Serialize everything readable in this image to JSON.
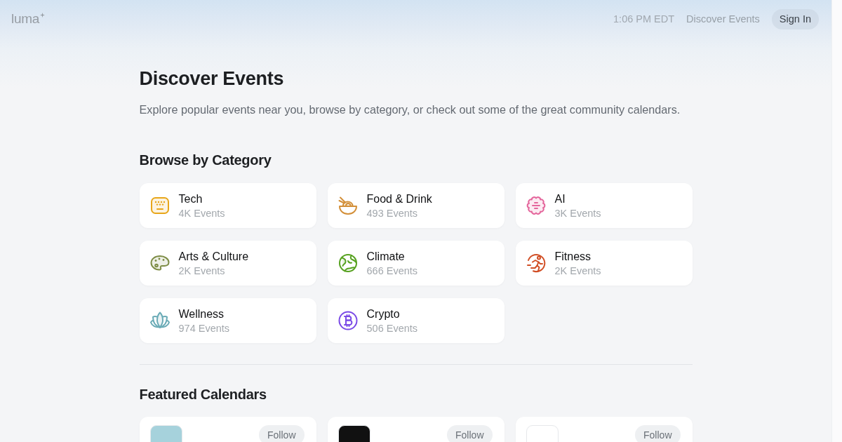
{
  "header": {
    "logo": "luma",
    "time": "1:06 PM EDT",
    "nav_link": "Discover Events",
    "sign_in": "Sign In"
  },
  "page": {
    "title": "Discover Events",
    "subtitle": "Explore popular events near you, browse by category, or check out some of the great community calendars."
  },
  "categories_section": {
    "heading": "Browse by Category",
    "items": [
      {
        "name": "Tech",
        "count": "4K Events",
        "kind": "keyboard",
        "color": "#e8a619"
      },
      {
        "name": "Food & Drink",
        "count": "493 Events",
        "kind": "bowl",
        "color": "#d38f38"
      },
      {
        "name": "AI",
        "count": "3K Events",
        "kind": "brain",
        "color": "#e4669c"
      },
      {
        "name": "Arts & Culture",
        "count": "2K Events",
        "kind": "palette",
        "color": "#7d8c45"
      },
      {
        "name": "Climate",
        "count": "666 Events",
        "kind": "globe",
        "color": "#56a11f"
      },
      {
        "name": "Fitness",
        "count": "2K Events",
        "kind": "runner",
        "color": "#d14f26"
      },
      {
        "name": "Wellness",
        "count": "974 Events",
        "kind": "lotus",
        "color": "#6aabb6"
      },
      {
        "name": "Crypto",
        "count": "506 Events",
        "kind": "bitcoin",
        "color": "#7a4ae6"
      }
    ]
  },
  "featured_section": {
    "heading": "Featured Calendars",
    "calendars": [
      {
        "color": "#a6d2dc",
        "follow": "Follow"
      },
      {
        "color": "#111111",
        "follow": "Follow"
      },
      {
        "color": "#ffffff",
        "follow": "Follow"
      }
    ]
  }
}
